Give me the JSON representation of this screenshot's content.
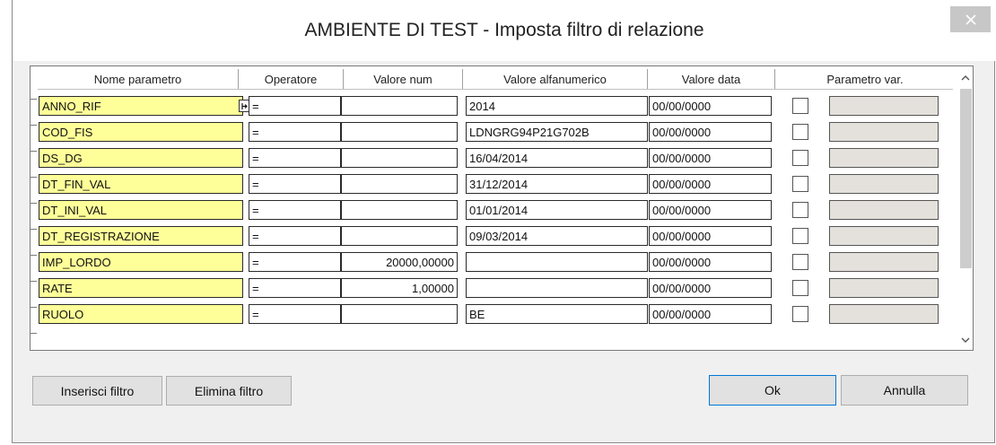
{
  "window": {
    "title": "AMBIENTE DI TEST - Imposta filtro di relazione"
  },
  "colors": {
    "name_cell": "#ffff99",
    "param_cell": "#e4e1dc",
    "default_button_border": "#0078d7"
  },
  "table": {
    "columns": [
      "Nome parametro",
      "Operatore",
      "Valore num",
      "Valore alfanumerico",
      "Valore data",
      "Parametro var."
    ],
    "rows": [
      {
        "name": "ANNO_RIF",
        "op": "=",
        "num": "",
        "alpha": "2014",
        "date": "00/00/0000",
        "checked": false
      },
      {
        "name": "COD_FIS",
        "op": "=",
        "num": "",
        "alpha": "LDNGRG94P21G702B",
        "date": "00/00/0000",
        "checked": false
      },
      {
        "name": "DS_DG",
        "op": "=",
        "num": "",
        "alpha": "16/04/2014",
        "date": "00/00/0000",
        "checked": false
      },
      {
        "name": "DT_FIN_VAL",
        "op": "=",
        "num": "",
        "alpha": "31/12/2014",
        "date": "00/00/0000",
        "checked": false
      },
      {
        "name": "DT_INI_VAL",
        "op": "=",
        "num": "",
        "alpha": "01/01/2014",
        "date": "00/00/0000",
        "checked": false
      },
      {
        "name": "DT_REGISTRAZIONE",
        "op": "=",
        "num": "",
        "alpha": "09/03/2014",
        "date": "00/00/0000",
        "checked": false
      },
      {
        "name": "IMP_LORDO",
        "op": "=",
        "num": "20000,00000",
        "alpha": "",
        "date": "00/00/0000",
        "checked": false
      },
      {
        "name": "RATE",
        "op": "=",
        "num": "1,00000",
        "alpha": "",
        "date": "00/00/0000",
        "checked": false
      },
      {
        "name": "RUOLO",
        "op": "=",
        "num": "",
        "alpha": "BE",
        "date": "00/00/0000",
        "checked": false
      }
    ]
  },
  "buttons": {
    "insert_filter": "Inserisci filtro",
    "delete_filter": "Elimina filtro",
    "ok": "Ok",
    "cancel": "Annulla"
  },
  "icons": {
    "close": "close-icon",
    "dropdown": "dropdown-icon",
    "scroll_up": "chevron-up-icon",
    "scroll_down": "chevron-down-icon"
  }
}
